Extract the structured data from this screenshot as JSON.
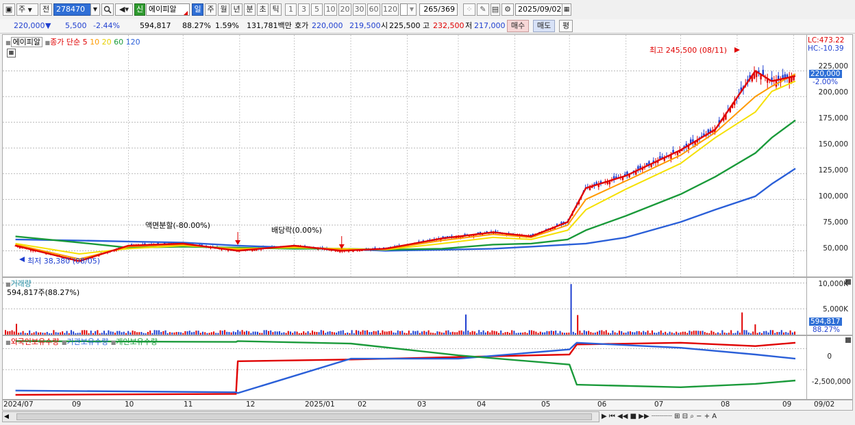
{
  "toolbar": {
    "type_label": "주",
    "prev_label": "전",
    "code_value": "278470",
    "stock_badge": "신",
    "stock_name": "에이피알",
    "periods": [
      "일",
      "주",
      "월",
      "년",
      "분",
      "초",
      "틱"
    ],
    "active_period": "일",
    "intervals": [
      "1",
      "3",
      "5",
      "10",
      "20",
      "30",
      "60",
      "120"
    ],
    "count_value": "265",
    "count_total": "/369",
    "date_value": "2025/09/02"
  },
  "quote": {
    "price": "220,000",
    "direction": "▼",
    "change": "5,500",
    "change_pct": "-2.44%",
    "volume": "594,817",
    "volume_ratio": "88.27%",
    "turnover_pct": "1.59%",
    "amount": "131,781백만",
    "bid_label": "호가",
    "bid": "220,000",
    "ask": "219,500",
    "open_label": "시",
    "open": "225,500",
    "high_label": "고",
    "high": "232,500",
    "low_label": "저",
    "low": "217,000",
    "buy_label": "매수",
    "sell_label": "매도",
    "eval_label": "평"
  },
  "price_panel": {
    "stock_label": "에이피알",
    "ma_title": "종가 단순",
    "ma_periods": [
      "5",
      "10",
      "20",
      "60",
      "120"
    ],
    "ma_colors": [
      "#e00000",
      "#ff9a00",
      "#f5e000",
      "#1a9a3a",
      "#2a5fd8"
    ],
    "lc_label": "LC:473.22",
    "hc_label": "HC:-10.39",
    "high_annotation": "최고 245,500 (08/11)",
    "low_annotation": "최저 38,380 (08/05)",
    "split_annotation": "액면분할(-80.00%)",
    "dividend_annotation": "배당락(0.00%)",
    "current_price_tag": "220,000",
    "current_pct_tag": "-2.00%"
  },
  "volume_panel": {
    "title": "거래량",
    "current_label": "594,817주(88.27%)",
    "current_tag": "594,817",
    "current_pct_tag": "88.27%"
  },
  "holding_panel": {
    "legends": [
      "외국인보유수량",
      "기관보유수량",
      "개인보유수량"
    ],
    "legend_colors": [
      "#e00000",
      "#2a5fd8",
      "#1a9a3a"
    ]
  },
  "x_axis": [
    "2024/07",
    "09",
    "10",
    "11",
    "12",
    "2025/01",
    "02",
    "03",
    "04",
    "05",
    "06",
    "07",
    "08",
    "09"
  ],
  "x_axis_right": "09/02",
  "chart_data": [
    {
      "type": "line",
      "title": "",
      "xlabel": "",
      "ylabel": "",
      "ylim": [
        25000,
        260000
      ],
      "y_ticks": [
        225000,
        200000,
        175000,
        150000,
        125000,
        100000,
        75000,
        50000
      ],
      "y_tick_labels": [
        "225,000",
        "200,000",
        "175,000",
        "150,000",
        "125,000",
        "100,000",
        "75,000",
        "50,000"
      ],
      "x": [
        "2024-07-01",
        "2024-08-05",
        "2024-09-01",
        "2024-10-01",
        "2024-10-31",
        "2024-12-01",
        "2024-12-27",
        "2025-01-20",
        "2025-02-20",
        "2025-03-20",
        "2025-04-10",
        "2025-04-30",
        "2025-05-10",
        "2025-06-01",
        "2025-07-01",
        "2025-07-20",
        "2025-08-11",
        "2025-08-20",
        "2025-09-02"
      ],
      "series": [
        {
          "name": "5",
          "values": [
            55000,
            40000,
            55000,
            57000,
            50000,
            55000,
            50000,
            52000,
            62000,
            68000,
            64000,
            78000,
            111000,
            123000,
            148000,
            168000,
            225000,
            215000,
            220000
          ]
        },
        {
          "name": "10",
          "values": [
            56000,
            42000,
            54000,
            56000,
            51000,
            54000,
            51000,
            51500,
            60000,
            66000,
            63000,
            75000,
            100000,
            118000,
            143000,
            165000,
            200000,
            210000,
            222000
          ]
        },
        {
          "name": "20",
          "values": [
            57000,
            47000,
            52000,
            55000,
            52000,
            53000,
            52000,
            51000,
            57000,
            63000,
            61000,
            70000,
            90000,
            110000,
            135000,
            160000,
            185000,
            205000,
            215000
          ]
        },
        {
          "name": "60",
          "values": [
            64000,
            58000,
            53000,
            54000,
            53000,
            52000,
            52000,
            51000,
            52000,
            56000,
            57000,
            61000,
            70000,
            84000,
            105000,
            122000,
            145000,
            160000,
            177000
          ]
        },
        {
          "name": "120",
          "values": [
            61000,
            60000,
            59000,
            58000,
            55000,
            53000,
            52000,
            50000,
            51000,
            52000,
            54000,
            56000,
            57000,
            63000,
            78000,
            90000,
            103000,
            115000,
            130000
          ]
        }
      ]
    },
    {
      "type": "bar",
      "title": "거래량",
      "ylim": [
        0,
        11000
      ],
      "y_ticks": [
        10000,
        5000
      ],
      "y_tick_labels": [
        "10,000K",
        "5,000K"
      ],
      "x": [
        "2024-07-01",
        "2024-10-31",
        "2025-03-05",
        "2025-05-02",
        "2025-05-05",
        "2025-08-04",
        "2025-08-11",
        "2025-09-02"
      ],
      "values": [
        2100,
        900,
        3900,
        9800,
        3800,
        4300,
        2000,
        595
      ]
    },
    {
      "type": "line",
      "title": "",
      "ylim": [
        -6000000,
        1500000
      ],
      "y_ticks": [
        0,
        -2500000
      ],
      "y_tick_labels": [
        "0",
        "-2,500,000"
      ],
      "x": [
        "2024-07-01",
        "2024-10-30",
        "2024-10-31",
        "2025-01-01",
        "2025-03-01",
        "2025-05-01",
        "2025-05-05",
        "2025-07-01",
        "2025-08-11",
        "2025-09-02"
      ],
      "series": [
        {
          "name": "외국인보유수량",
          "values": [
            -5500000,
            -5400000,
            -1500000,
            -1300000,
            -1000000,
            -700000,
            500000,
            700000,
            300000,
            700000
          ]
        },
        {
          "name": "기관보유수량",
          "values": [
            -5000000,
            -5200000,
            -5300000,
            -1200000,
            -1200000,
            -100000,
            700000,
            100000,
            -700000,
            -1200000
          ]
        },
        {
          "name": "개인보유수량",
          "values": [
            900000,
            800000,
            900000,
            600000,
            -800000,
            -1900000,
            -4300000,
            -4600000,
            -4200000,
            -3800000
          ]
        }
      ]
    }
  ]
}
